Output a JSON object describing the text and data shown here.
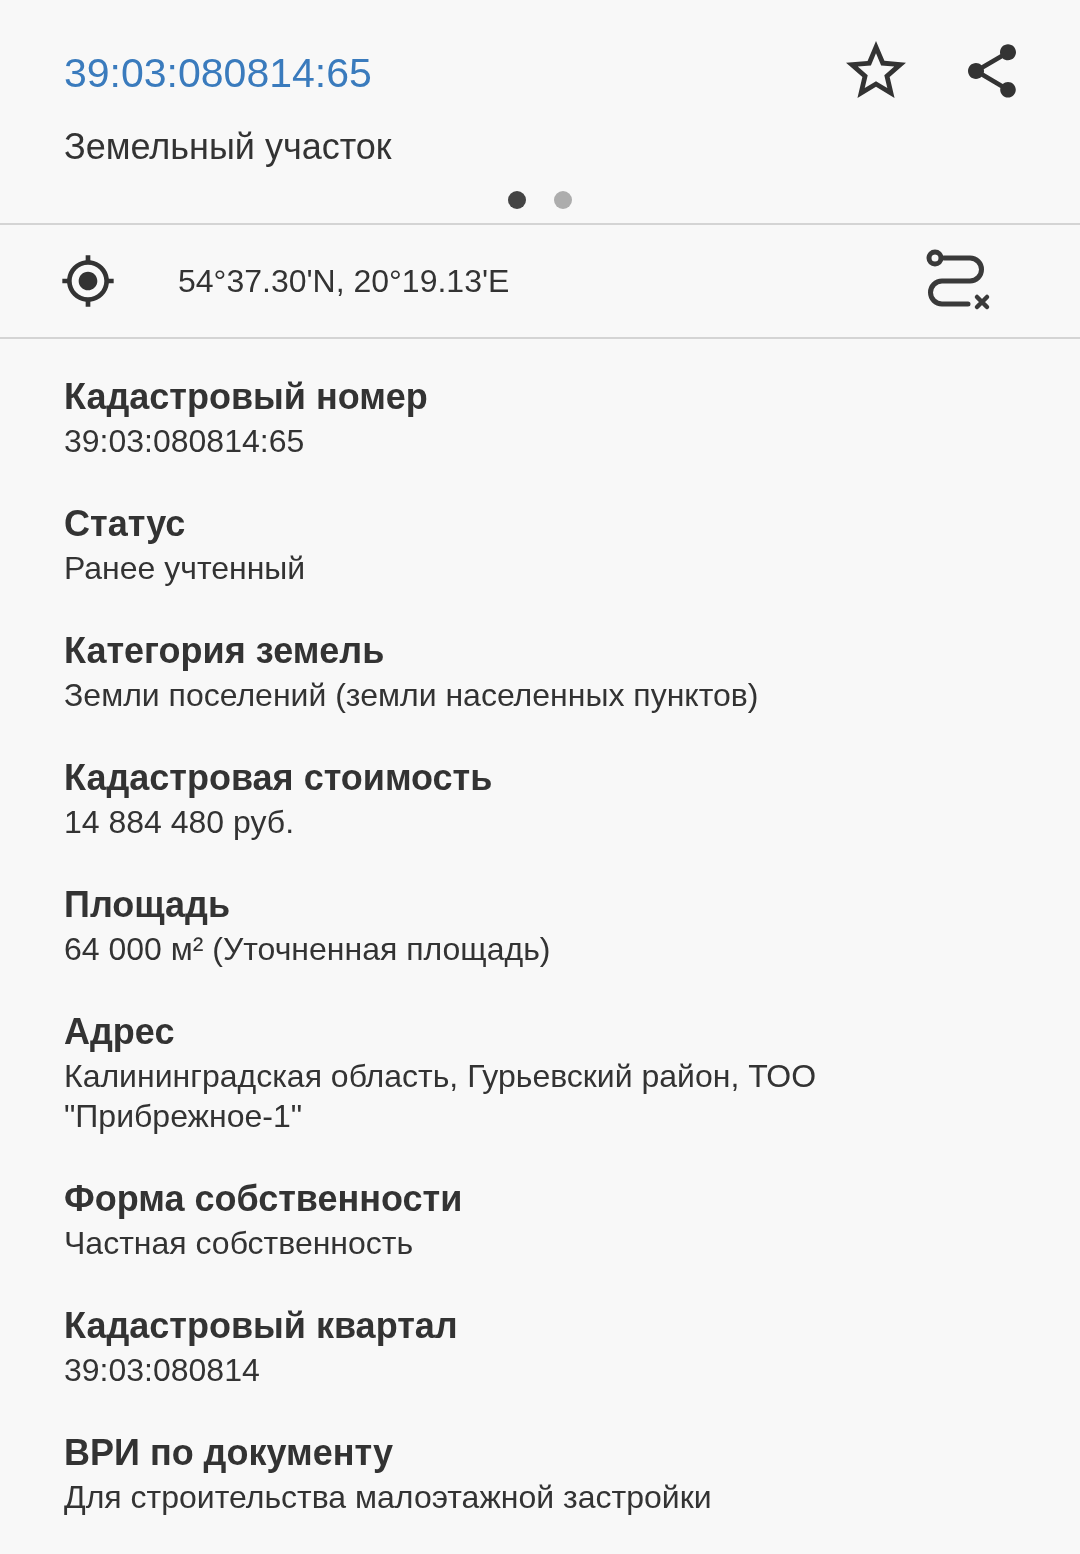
{
  "header": {
    "title": "39:03:080814:65",
    "subtitle": "Земельный участок",
    "pager": [
      {
        "selected": true
      },
      {
        "selected": false
      }
    ]
  },
  "location": {
    "coordinates": "54°37.30'N, 20°19.13'E"
  },
  "fields": [
    {
      "label": "Кадастровый номер",
      "value": "39:03:080814:65"
    },
    {
      "label": "Статус",
      "value": "Ранее учтенный"
    },
    {
      "label": "Категория земель",
      "value": "Земли поселений (земли населенных пунктов)"
    },
    {
      "label": "Кадастровая стоимость",
      "value": "14 884 480 руб."
    },
    {
      "label": "Площадь",
      "value": "64 000 м² (Уточненная площадь)"
    },
    {
      "label": "Адрес",
      "value": "Калининградская область, Гурьевский район, ТОО \"Прибрежное-1\""
    },
    {
      "label": "Форма собственности",
      "value": "Частная собственность"
    },
    {
      "label": "Кадастровый квартал",
      "value": "39:03:080814"
    },
    {
      "label": "ВРИ по документу",
      "value": "Для строительства малоэтажной застройки"
    }
  ]
}
